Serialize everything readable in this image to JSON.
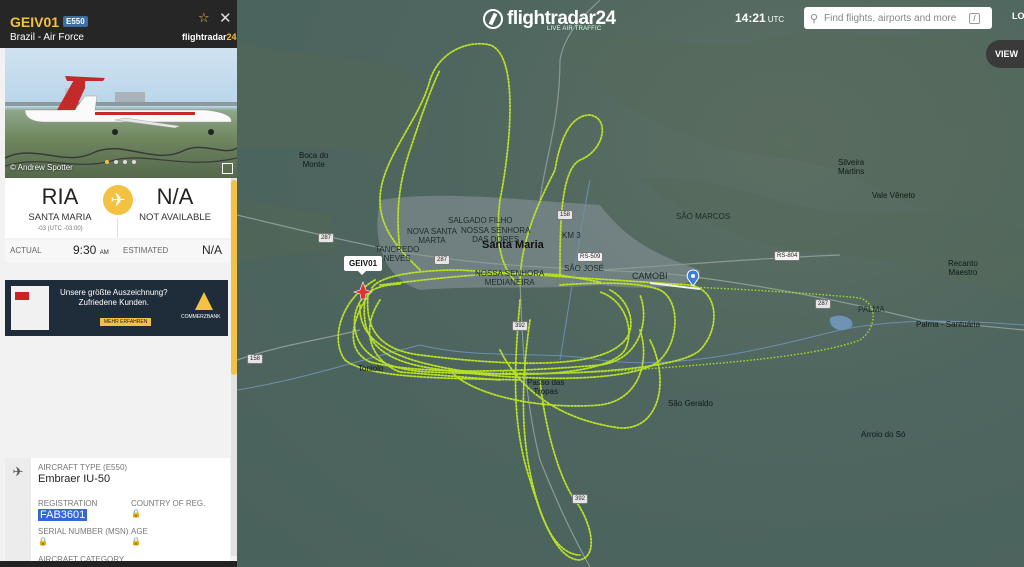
{
  "header": {
    "logo": "flightradar24",
    "tagline": "LIVE AIR TRAFFIC",
    "time": "14:21",
    "timezone": "UTC",
    "search_placeholder": "Find flights, airports and more",
    "search_kbd": "/",
    "login": "LO",
    "view_button": "VIEW"
  },
  "flight": {
    "callsign": "GEIV01",
    "type_badge": "E550",
    "airline": "Brazil - Air Force",
    "brand": "flightradar",
    "brand_num": "24",
    "photo_credit": "© Andrew Spotter",
    "origin": {
      "code": "RIA",
      "city": "SANTA MARIA",
      "tz": "-03 (UTC -03:00)"
    },
    "destination": {
      "code": "N/A",
      "city": "NOT AVAILABLE"
    },
    "actual_label": "ACTUAL",
    "actual_time": "9:30",
    "actual_ampm": "AM",
    "estimated_label": "ESTIMATED",
    "estimated_time": "N/A",
    "map_label": "GEIV01"
  },
  "ad": {
    "line1": "Unsere größte Auszeichnung?",
    "line2": "Zufriedene Kunden.",
    "cta": "MEHR ERFAHREN",
    "brand": "COMMERZBANK"
  },
  "details": {
    "aircraft_type_label": "AIRCRAFT TYPE (E550)",
    "aircraft_type": "Embraer IU-50",
    "registration_label": "REGISTRATION",
    "registration": "FAB3601",
    "country_label": "COUNTRY OF REG.",
    "msn_label": "SERIAL NUMBER (MSN)",
    "age_label": "AGE",
    "category_label": "AIRCRAFT CATEGORY"
  },
  "map": {
    "places": {
      "boca_do_monte": "Boca do\nMonte",
      "santa_maria": "Santa Maria",
      "salgado_filho": "SALGADO FILHO",
      "nossa_senhora_das_dores": "NOSSA SENHORA\nDAS DORES",
      "nova_santa_marta": "NOVA SANTA\nMARTA",
      "km3": "KM 3",
      "tancredo_neves": "TANCREDO\nNEVES",
      "nossa_senhora_do_rosario": "DO ROSÁRIO",
      "nossa_senhora_de_medianeira": "NOSSA SENHORA\nMEDIANEIRA",
      "sao_jose": "SÃO JOSÉ",
      "camobi": "CAMOBI",
      "sao_marcos": "SÃO MARCOS",
      "silveira_martins": "Silveira\nMartins",
      "vale_veneto": "Vale Vêneto",
      "recanto_maestro": "Recanto\nMaestro",
      "palma": "PALMA",
      "palma_santuaria": "Palma - Santuária",
      "toniolo": "Toniolo",
      "passo_das_tropas": "Passo das\nTropas",
      "sao_geraldo": "São Geraldo",
      "arroio_do_so": "Arroio do Só"
    },
    "shields": {
      "s158_top": "158",
      "s287_left": "287",
      "s287_mid": "287",
      "s287_right": "287",
      "rs509": "RS-509",
      "rs804": "RS-804",
      "s158_left": "158",
      "s392_mid": "392",
      "s392_bottom": "392"
    }
  }
}
